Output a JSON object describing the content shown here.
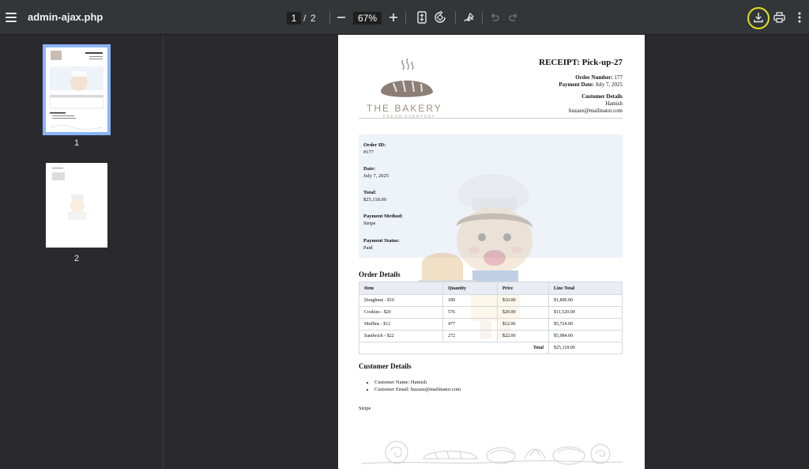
{
  "toolbar": {
    "title": "admin-ajax.php",
    "current_page": "1",
    "page_separator": "/",
    "total_pages": "2",
    "zoom": "67%"
  },
  "sidebar": {
    "thumbnails": [
      {
        "label": "1"
      },
      {
        "label": "2"
      }
    ]
  },
  "receipt": {
    "logo_name": "THE BAKERY",
    "logo_tagline": "FRESH EVERYDAY",
    "title": "RECEIPT: Pick-up-27",
    "order_number_label": "Order Number:",
    "order_number": "177",
    "payment_date_label": "Payment Date:",
    "payment_date": "July 7, 2025",
    "customer_details_label": "Customer Details",
    "customer_name": "Hamish",
    "customer_email": "huzaze@mailinator.com",
    "info": [
      {
        "label": "Order ID:",
        "value": "#177"
      },
      {
        "label": "Date:",
        "value": "July 7, 2025"
      },
      {
        "label": "Total:",
        "value": "$25,118.00"
      },
      {
        "label": "Payment Method:",
        "value": "Stripe"
      },
      {
        "label": "Payment Status:",
        "value": "Paid"
      }
    ],
    "order_details_heading": "Order Details",
    "table_headers": [
      "Item",
      "Quantity",
      "Price",
      "Line Total"
    ],
    "rows": [
      {
        "item": "Doughnut - $10",
        "qty": "189",
        "price": "$10.00",
        "line": "$1,890.00"
      },
      {
        "item": "Cookies - $20",
        "qty": "576",
        "price": "$20.00",
        "line": "$11,520.00"
      },
      {
        "item": "Muffins - $12",
        "qty": "477",
        "price": "$12.00",
        "line": "$5,724.00"
      },
      {
        "item": "Sandwich - $22",
        "qty": "272",
        "price": "$22.00",
        "line": "$5,984.00"
      }
    ],
    "total_label": "Total",
    "total_value": "$25,118.00",
    "customer_heading": "Customer Details",
    "customer_list": [
      "Customer Name: Hamish",
      "Customer Email: huzaze@mailinator.com"
    ],
    "payment_note": "Stripe"
  },
  "colors": {
    "toolbar_bg": "#323639",
    "viewer_bg": "#2a2a2e",
    "thumb_active": "#8ab4f8",
    "download_highlight": "#e6e020"
  }
}
